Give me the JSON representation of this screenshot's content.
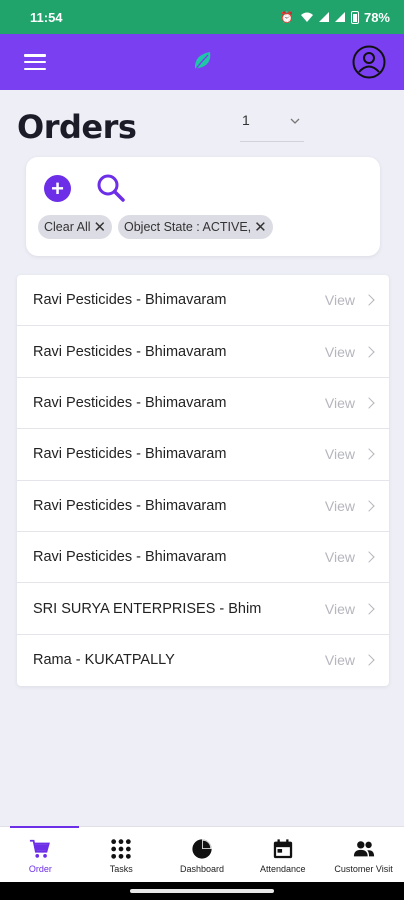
{
  "status_bar": {
    "time": "11:54",
    "battery": "78%",
    "icons": [
      "alarm-icon",
      "wifi-icon",
      "signal-icon",
      "signal-icon",
      "battery-icon"
    ]
  },
  "app_bar": {
    "brand_color": "#7b3ff2",
    "icons": [
      "menu-icon",
      "leaf-logo-icon",
      "profile-icon"
    ]
  },
  "page": {
    "title": "Orders",
    "page_select_value": "1"
  },
  "filters": {
    "chips": [
      {
        "label": "Clear All"
      },
      {
        "label": "Object State : ACTIVE,"
      }
    ]
  },
  "orders": [
    {
      "name": "Ravi Pesticides - Bhimavaram",
      "action": "View"
    },
    {
      "name": "Ravi Pesticides - Bhimavaram",
      "action": "View"
    },
    {
      "name": "Ravi Pesticides - Bhimavaram",
      "action": "View"
    },
    {
      "name": "Ravi Pesticides - Bhimavaram",
      "action": "View"
    },
    {
      "name": "Ravi Pesticides - Bhimavaram",
      "action": "View"
    },
    {
      "name": "Ravi Pesticides - Bhimavaram",
      "action": "View"
    },
    {
      "name": "SRI SURYA ENTERPRISES - Bhim",
      "action": "View"
    },
    {
      "name": "Rama - KUKATPALLY",
      "action": "View"
    }
  ],
  "bottom_nav": {
    "active_color": "#6c2ee6",
    "items": [
      {
        "label": "Order",
        "icon": "cart-icon",
        "active": true
      },
      {
        "label": "Tasks",
        "icon": "grid-icon",
        "active": false
      },
      {
        "label": "Dashboard",
        "icon": "pie-chart-icon",
        "active": false
      },
      {
        "label": "Attendance",
        "icon": "calendar-icon",
        "active": false
      },
      {
        "label": "Customer Visit",
        "icon": "people-icon",
        "active": false
      }
    ]
  }
}
